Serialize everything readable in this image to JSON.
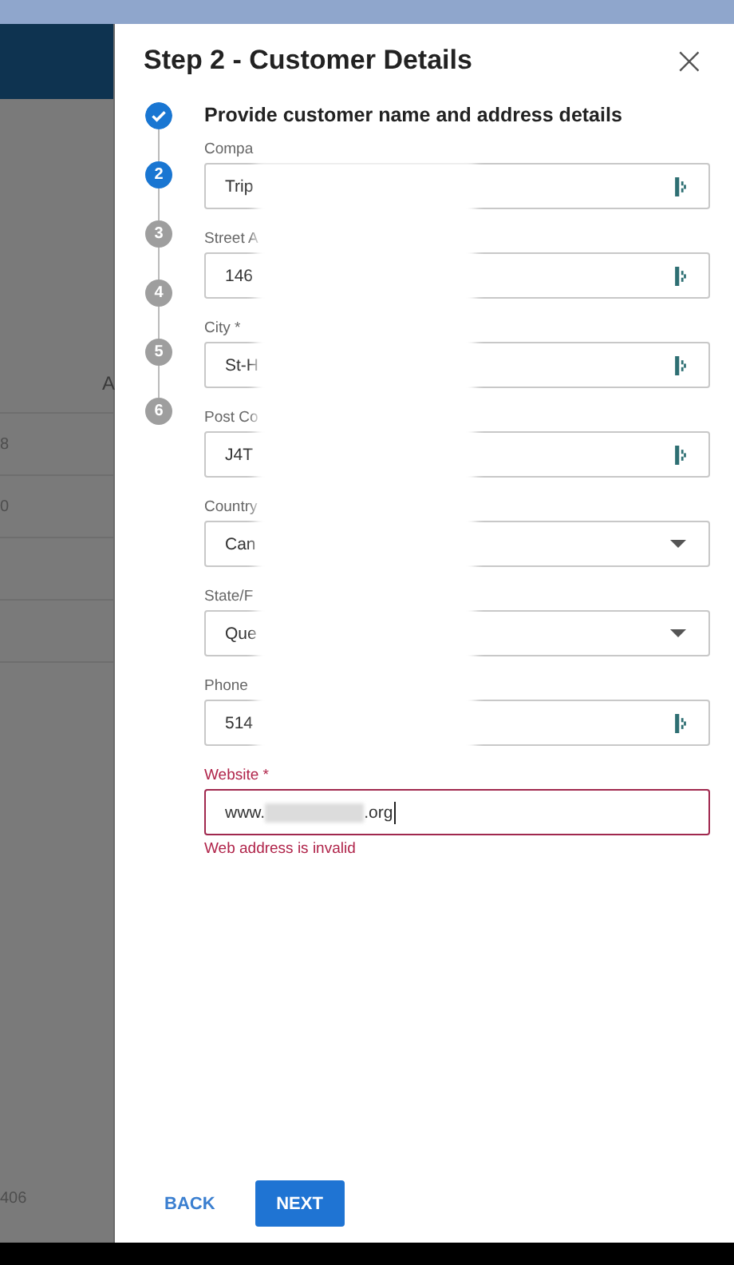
{
  "backdrop": {
    "texts": [
      "A",
      "8",
      "0",
      "406"
    ]
  },
  "dialog": {
    "title": "Step 2 - Customer Details",
    "close": "×"
  },
  "steps": [
    {
      "completed": true,
      "selected": false
    },
    {
      "number": "2",
      "completed": false,
      "selected": true
    },
    {
      "number": "3",
      "completed": false,
      "selected": false
    },
    {
      "number": "4",
      "completed": false,
      "selected": false
    },
    {
      "number": "5",
      "completed": false,
      "selected": false
    },
    {
      "number": "6",
      "completed": false,
      "selected": false
    }
  ],
  "heading": "Provide customer name and address details",
  "fields": [
    {
      "label": "Compa",
      "value": "Trip",
      "kind": "text",
      "error": false
    },
    {
      "label": "Street A",
      "value": "146",
      "kind": "text",
      "error": false
    },
    {
      "label": "City *",
      "value": "St-H",
      "kind": "text",
      "error": false
    },
    {
      "label": "Post Co",
      "value": "J4T",
      "kind": "text",
      "error": false
    },
    {
      "label": "Country",
      "value": "Can",
      "kind": "select",
      "error": false
    },
    {
      "label": "State/F",
      "value": "Que",
      "kind": "select",
      "error": false
    },
    {
      "label": "Phone",
      "value": "514",
      "kind": "text",
      "error": false
    },
    {
      "label": "Website *",
      "value": "www.",
      "value_end": ".org",
      "kind": "url",
      "error": true,
      "message": "Web address is invalid"
    }
  ],
  "buttons": [
    {
      "label": "BACK",
      "kind": "text"
    },
    {
      "label": "NEXT",
      "kind": "primary"
    }
  ]
}
